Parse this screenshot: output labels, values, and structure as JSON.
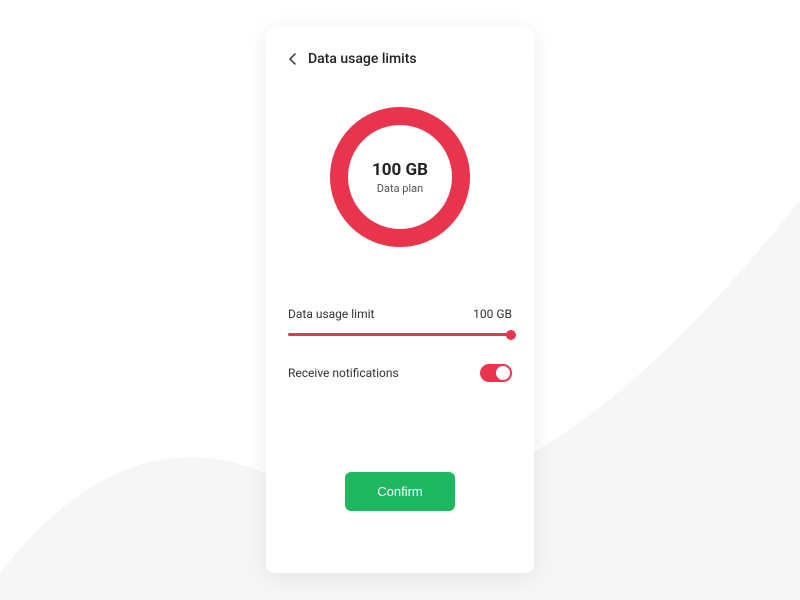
{
  "header": {
    "title": "Data usage limits"
  },
  "ring": {
    "value": "100 GB",
    "label": "Data plan"
  },
  "slider": {
    "label": "Data usage limit",
    "value": "100 GB"
  },
  "toggle": {
    "label": "Receive notifications",
    "on": true
  },
  "confirm": {
    "label": "Confirm"
  },
  "colors": {
    "accent": "#e9344e",
    "primary": "#1fb860"
  }
}
